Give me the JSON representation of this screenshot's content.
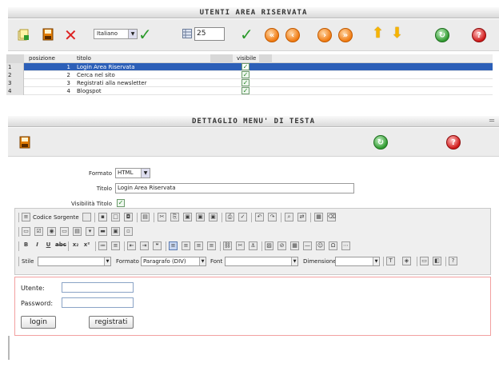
{
  "headers": {
    "top": "UTENTI AREA RISERVATA",
    "detail": "DETTAGLIO MENU' DI TESTA"
  },
  "toolbar": {
    "language": "Italiano",
    "page_size": "25"
  },
  "grid": {
    "columns": [
      "posizione",
      "titolo",
      "visibile"
    ],
    "rows": [
      {
        "rn": "1",
        "pos": "1",
        "title": "Login Area Riservata",
        "visible": "✓",
        "selected": true
      },
      {
        "rn": "2",
        "pos": "2",
        "title": "Cerca nel sito",
        "visible": "✓",
        "selected": false
      },
      {
        "rn": "3",
        "pos": "3",
        "title": "Registrati alla newsletter",
        "visible": "✓",
        "selected": false
      },
      {
        "rn": "4",
        "pos": "4",
        "title": "Blogspot",
        "visible": "✓",
        "selected": false
      }
    ]
  },
  "form": {
    "format_label": "Formato",
    "format_value": "HTML",
    "title_label": "Titolo",
    "title_value": "Login Area Riservata",
    "visibility_label": "Visibilità Titolo",
    "visibility_check": "✓"
  },
  "editor": {
    "source_label": "Codice Sorgente",
    "style_label": "Stile",
    "format_label": "Formato",
    "format_value": "Paragrafo (DIV)",
    "font_label": "Font",
    "size_label": "Dimensione"
  },
  "content": {
    "user_label": "Utente:",
    "password_label": "Password:",
    "login_button": "login",
    "register_button": "registrati"
  },
  "colors": {
    "selection": "#2c5fb8",
    "accent_orange": "#f07a10",
    "accent_green": "#2f9a2f",
    "accent_red": "#d01818"
  }
}
